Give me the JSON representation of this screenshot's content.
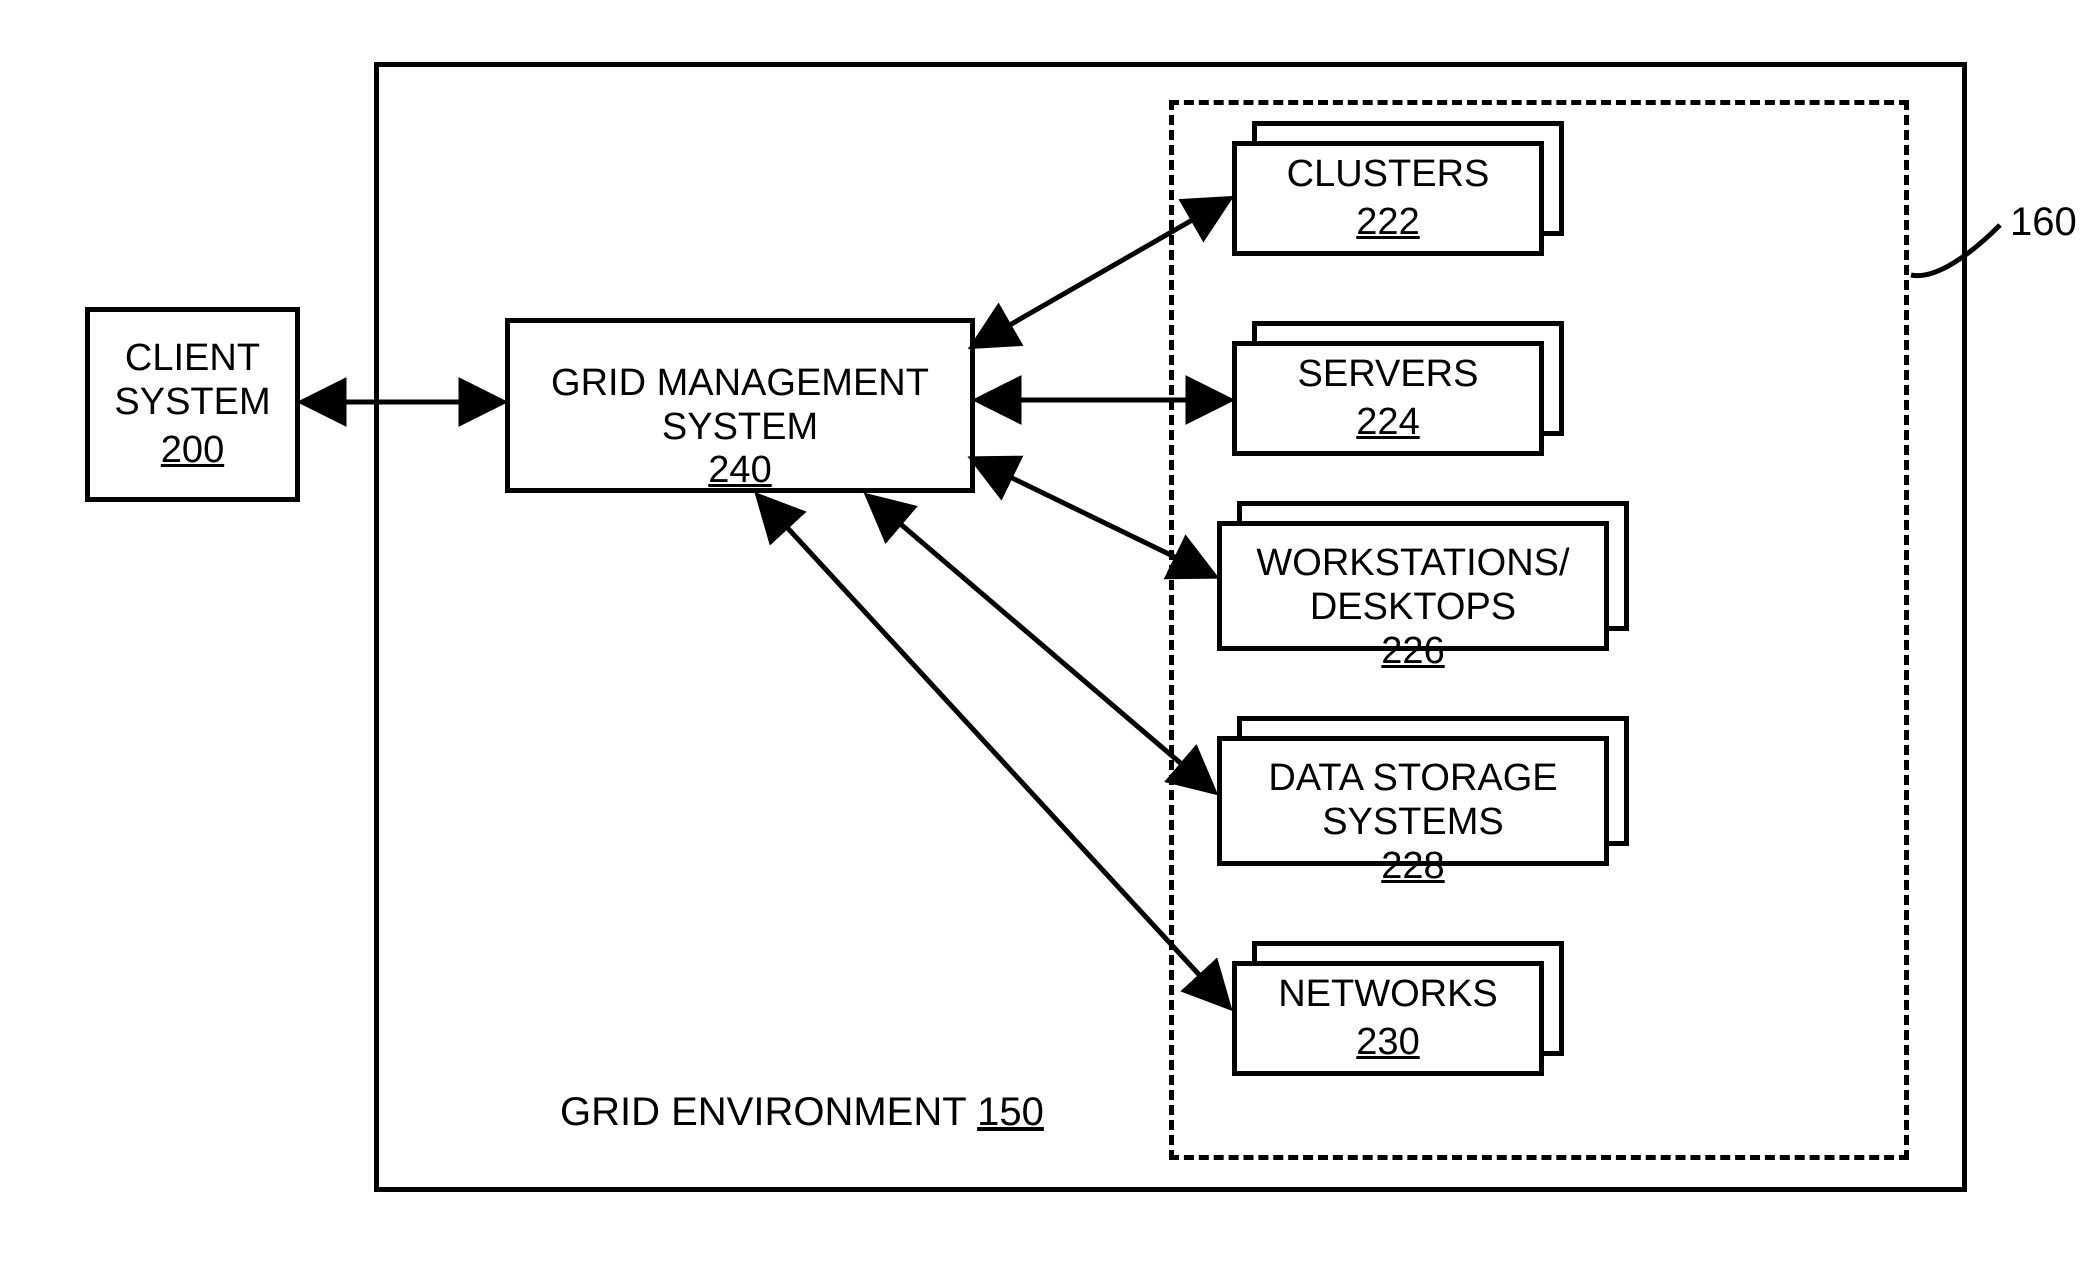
{
  "client": {
    "label": "CLIENT\nSYSTEM",
    "ref": "200"
  },
  "gms": {
    "label": "GRID MANAGEMENT\nSYSTEM",
    "ref": "240"
  },
  "env": {
    "label": "GRID ENVIRONMENT",
    "ref": "150"
  },
  "group": {
    "ref": "160"
  },
  "resources": {
    "clusters": {
      "label": "CLUSTERS",
      "ref": "222"
    },
    "servers": {
      "label": "SERVERS",
      "ref": "224"
    },
    "workstations": {
      "label": "WORKSTATIONS/\nDESKTOPS",
      "ref": "226"
    },
    "storage": {
      "label": "DATA STORAGE\nSYSTEMS",
      "ref": "228"
    },
    "networks": {
      "label": "NETWORKS",
      "ref": "230"
    }
  }
}
